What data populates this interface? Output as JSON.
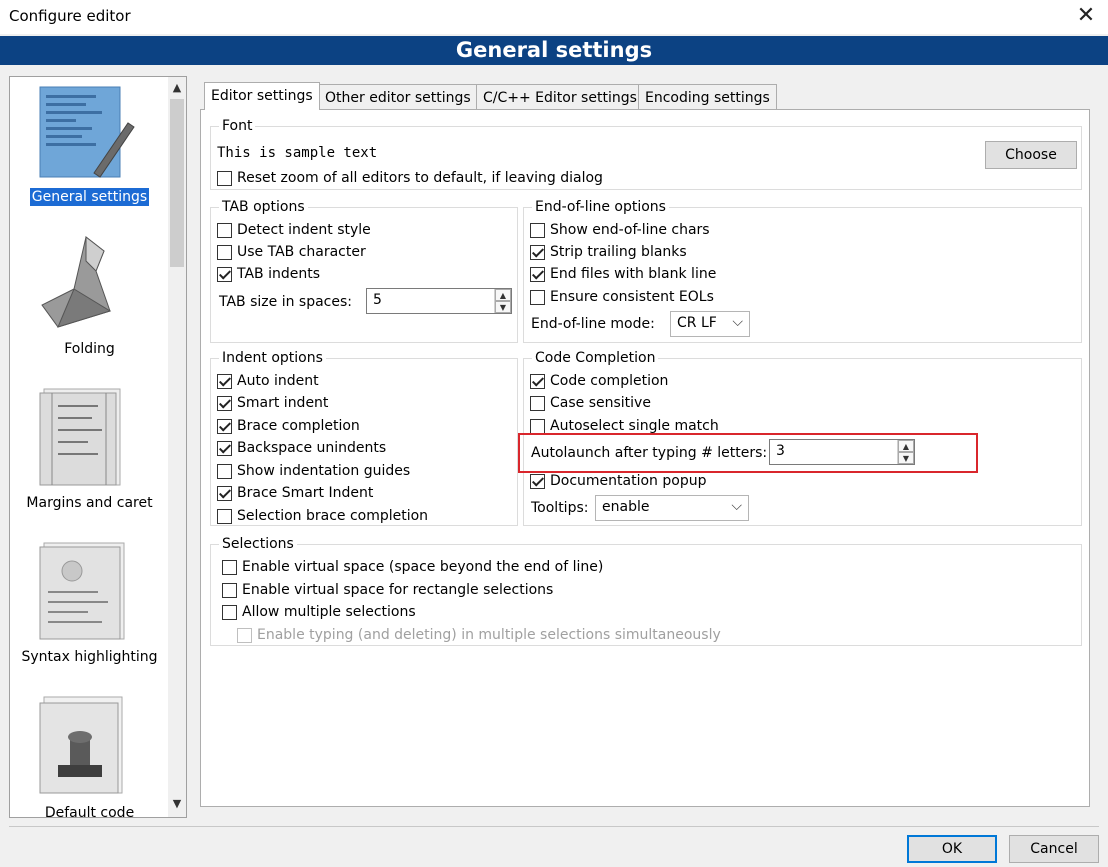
{
  "window": {
    "title": "Configure editor",
    "close_glyph": "✕"
  },
  "banner": {
    "title": "General settings"
  },
  "sidebar": {
    "items": [
      {
        "label": "General settings",
        "selected": true
      },
      {
        "label": "Folding"
      },
      {
        "label": "Margins and caret"
      },
      {
        "label": "Syntax highlighting"
      },
      {
        "label": "Default code"
      }
    ]
  },
  "tabs": [
    "Editor settings",
    "Other editor settings",
    "C/C++ Editor settings",
    "Encoding settings"
  ],
  "font_group": {
    "title": "Font",
    "sample": "This is sample text",
    "reset_zoom": "Reset zoom of all editors to default, if leaving dialog",
    "choose_label": "Choose"
  },
  "tab_options": {
    "title": "TAB options",
    "detect_indent": "Detect indent style",
    "use_tab": "Use TAB character",
    "tab_indents": "TAB indents",
    "tab_size_label": "TAB size in spaces:",
    "tab_size_value": "5"
  },
  "eol_options": {
    "title": "End-of-line options",
    "show_eol": "Show end-of-line chars",
    "strip_trailing": "Strip trailing blanks",
    "end_blank": "End files with blank line",
    "consistent_eol": "Ensure consistent EOLs",
    "mode_label": "End-of-line mode:",
    "mode_value": "CR LF"
  },
  "indent_options": {
    "title": "Indent options",
    "auto_indent": "Auto indent",
    "smart_indent": "Smart indent",
    "brace_completion": "Brace completion",
    "backspace_unindents": "Backspace unindents",
    "show_guides": "Show indentation guides",
    "brace_smart": "Brace Smart Indent",
    "selection_brace": "Selection brace completion"
  },
  "code_completion": {
    "title": "Code Completion",
    "code_completion": "Code completion",
    "case_sensitive": "Case sensitive",
    "autoselect": "Autoselect single match",
    "autolaunch_label": "Autolaunch after typing # letters:",
    "autolaunch_value": "3",
    "doc_popup": "Documentation popup",
    "tooltips_label": "Tooltips:",
    "tooltips_value": "enable"
  },
  "selections": {
    "title": "Selections",
    "virtual_space": "Enable virtual space (space beyond the end of line)",
    "virtual_rect": "Enable virtual space for rectangle selections",
    "multiple": "Allow multiple selections",
    "multi_typing": "Enable typing (and deleting) in multiple selections simultaneously"
  },
  "footer": {
    "ok_label": "OK",
    "cancel_label": "Cancel"
  },
  "colors": {
    "banner": "#0c4283",
    "highlight": "#d9262c",
    "selection": "#1c6bd4"
  }
}
